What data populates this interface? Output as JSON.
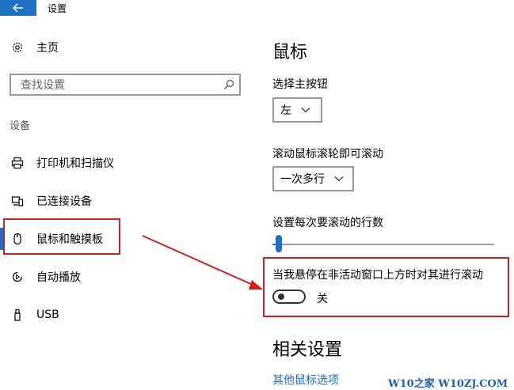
{
  "window": {
    "title": "设置"
  },
  "sidebar": {
    "home_label": "主页",
    "search_placeholder": "查找设置",
    "section_label": "设备",
    "items": [
      {
        "label": "打印机和扫描仪",
        "icon": "printer-icon"
      },
      {
        "label": "已连接设备",
        "icon": "devices-icon"
      },
      {
        "label": "鼠标和触摸板",
        "icon": "mouse-icon",
        "active": true
      },
      {
        "label": "自动播放",
        "icon": "autoplay-icon"
      },
      {
        "label": "USB",
        "icon": "usb-icon"
      }
    ]
  },
  "main": {
    "heading": "鼠标",
    "primary_button": {
      "label": "选择主按钮",
      "value": "左"
    },
    "scroll_mode": {
      "label": "滚动鼠标滚轮即可滚动",
      "value": "一次多行"
    },
    "scroll_lines": {
      "label": "设置每次要滚动的行数",
      "value_fraction": 0.03
    },
    "inactive_scroll": {
      "label": "当我悬停在非活动窗口上方时对其进行滚动",
      "state_label": "关",
      "on": false
    },
    "related": {
      "heading": "相关设置",
      "link": "其他鼠标选项"
    }
  },
  "watermark": "W10之家 W10ZJ.COM",
  "colors": {
    "accent": "#1f6fc4",
    "annotation": "#d0201c"
  }
}
